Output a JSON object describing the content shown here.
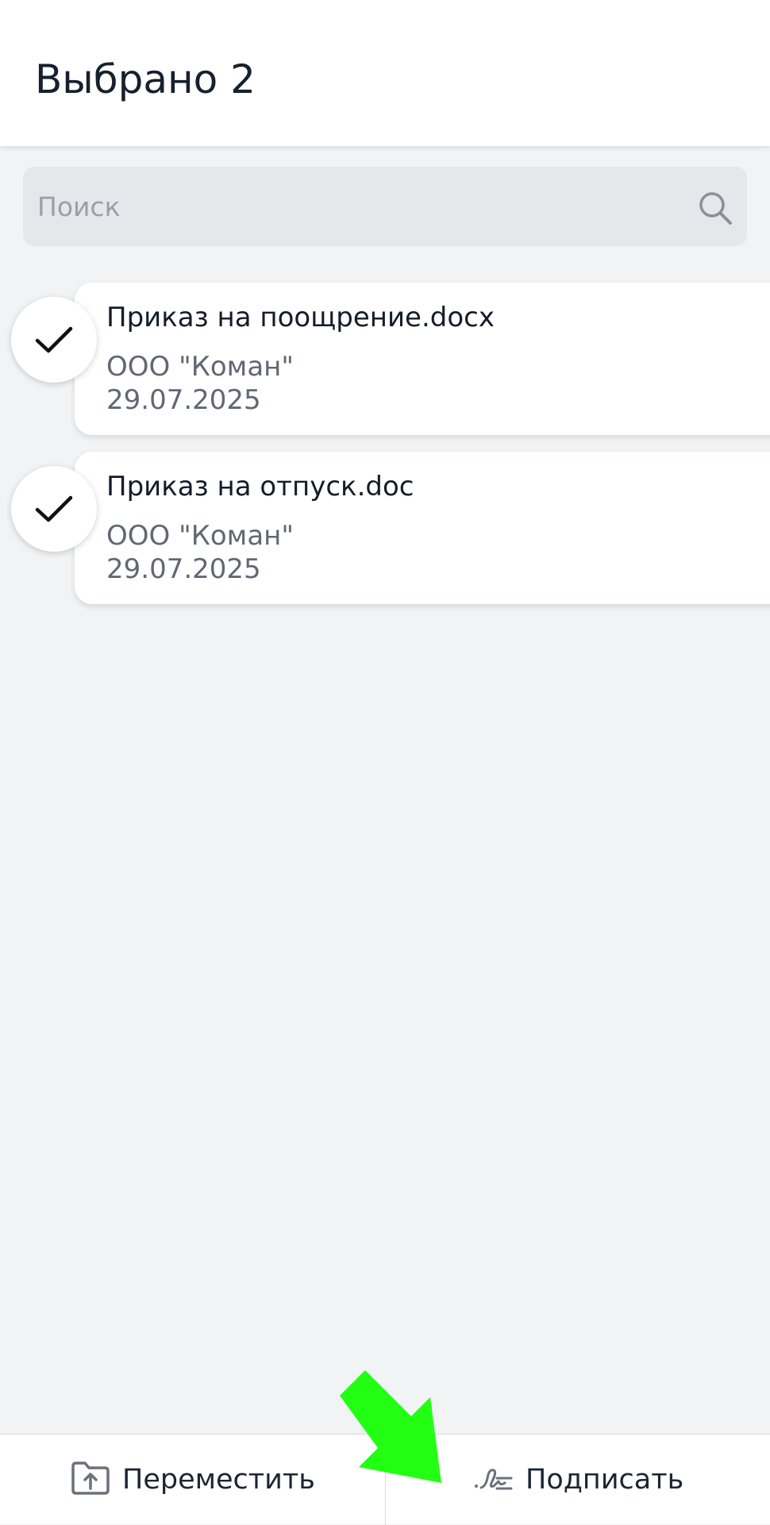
{
  "header": {
    "title": "Выбрано 2"
  },
  "search": {
    "placeholder": "Поиск",
    "value": "",
    "icon": "search-icon"
  },
  "documents": [
    {
      "name": "Приказ на поощрение.docx",
      "organization": "ООО \"Коман\"",
      "date": "29.07.2025",
      "selected": true
    },
    {
      "name": "Приказ на отпуск.doc",
      "organization": "ООО \"Коман\"",
      "date": "29.07.2025",
      "selected": true
    }
  ],
  "bottom_bar": {
    "move": {
      "label": "Переместить",
      "icon": "folder-upload-icon"
    },
    "sign": {
      "label": "Подписать",
      "icon": "signature-icon"
    }
  },
  "annotation": {
    "icon": "arrow-pointer-icon",
    "color": "#22ff12"
  },
  "colors": {
    "background": "#f1f3f5",
    "card": "#ffffff",
    "search_bg": "#e5e7eb",
    "text_secondary": "#616873"
  }
}
